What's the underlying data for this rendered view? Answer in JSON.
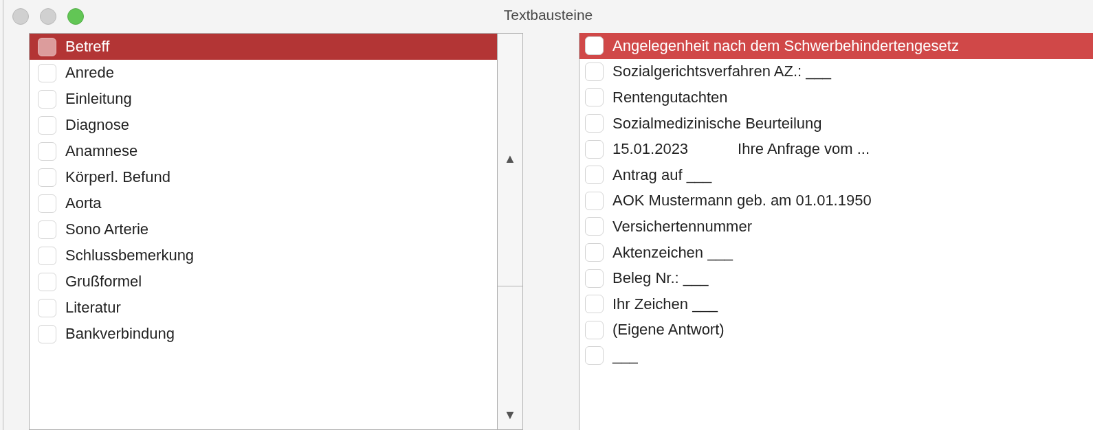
{
  "window": {
    "title": "Textbausteine"
  },
  "sections": [
    {
      "label": "Betreff",
      "selected": true,
      "checked": false
    },
    {
      "label": "Anrede",
      "selected": false,
      "checked": false
    },
    {
      "label": "Einleitung",
      "selected": false,
      "checked": false
    },
    {
      "label": "Diagnose",
      "selected": false,
      "checked": false
    },
    {
      "label": "Anamnese",
      "selected": false,
      "checked": false
    },
    {
      "label": "Körperl. Befund",
      "selected": false,
      "checked": false
    },
    {
      "label": "Aorta",
      "selected": false,
      "checked": false
    },
    {
      "label": "Sono Arterie",
      "selected": false,
      "checked": false
    },
    {
      "label": "Schlussbemerkung",
      "selected": false,
      "checked": false
    },
    {
      "label": "Grußformel",
      "selected": false,
      "checked": false
    },
    {
      "label": "Literatur",
      "selected": false,
      "checked": false
    },
    {
      "label": "Bankverbindung",
      "selected": false,
      "checked": false
    }
  ],
  "scrollbar": {
    "up": "▲",
    "down": "▼"
  },
  "phrases": [
    {
      "label": "Angelegenheit nach dem Schwerbehindertengesetz",
      "selected": true,
      "checked": false
    },
    {
      "label": "Sozialgerichtsverfahren AZ.: ___",
      "selected": false,
      "checked": false
    },
    {
      "label": "Rentengutachten",
      "selected": false,
      "checked": false
    },
    {
      "label": "Sozialmedizinische Beurteilung",
      "selected": false,
      "checked": false
    },
    {
      "label": "15.01.2023",
      "column_2": "Ihre Anfrage vom ...",
      "selected": false,
      "checked": false
    },
    {
      "label": "Antrag auf ___",
      "selected": false,
      "checked": false
    },
    {
      "label": "AOK Mustermann geb. am 01.01.1950",
      "selected": false,
      "checked": false
    },
    {
      "label": "Versichertennummer",
      "selected": false,
      "checked": false
    },
    {
      "label": "Aktenzeichen ___",
      "selected": false,
      "checked": false
    },
    {
      "label": "Beleg Nr.: ___",
      "selected": false,
      "checked": false
    },
    {
      "label": "Ihr Zeichen ___",
      "selected": false,
      "checked": false
    },
    {
      "label": "(Eigene Antwort)",
      "selected": false,
      "checked": false
    },
    {
      "label": "___",
      "selected": false,
      "checked": false
    }
  ]
}
